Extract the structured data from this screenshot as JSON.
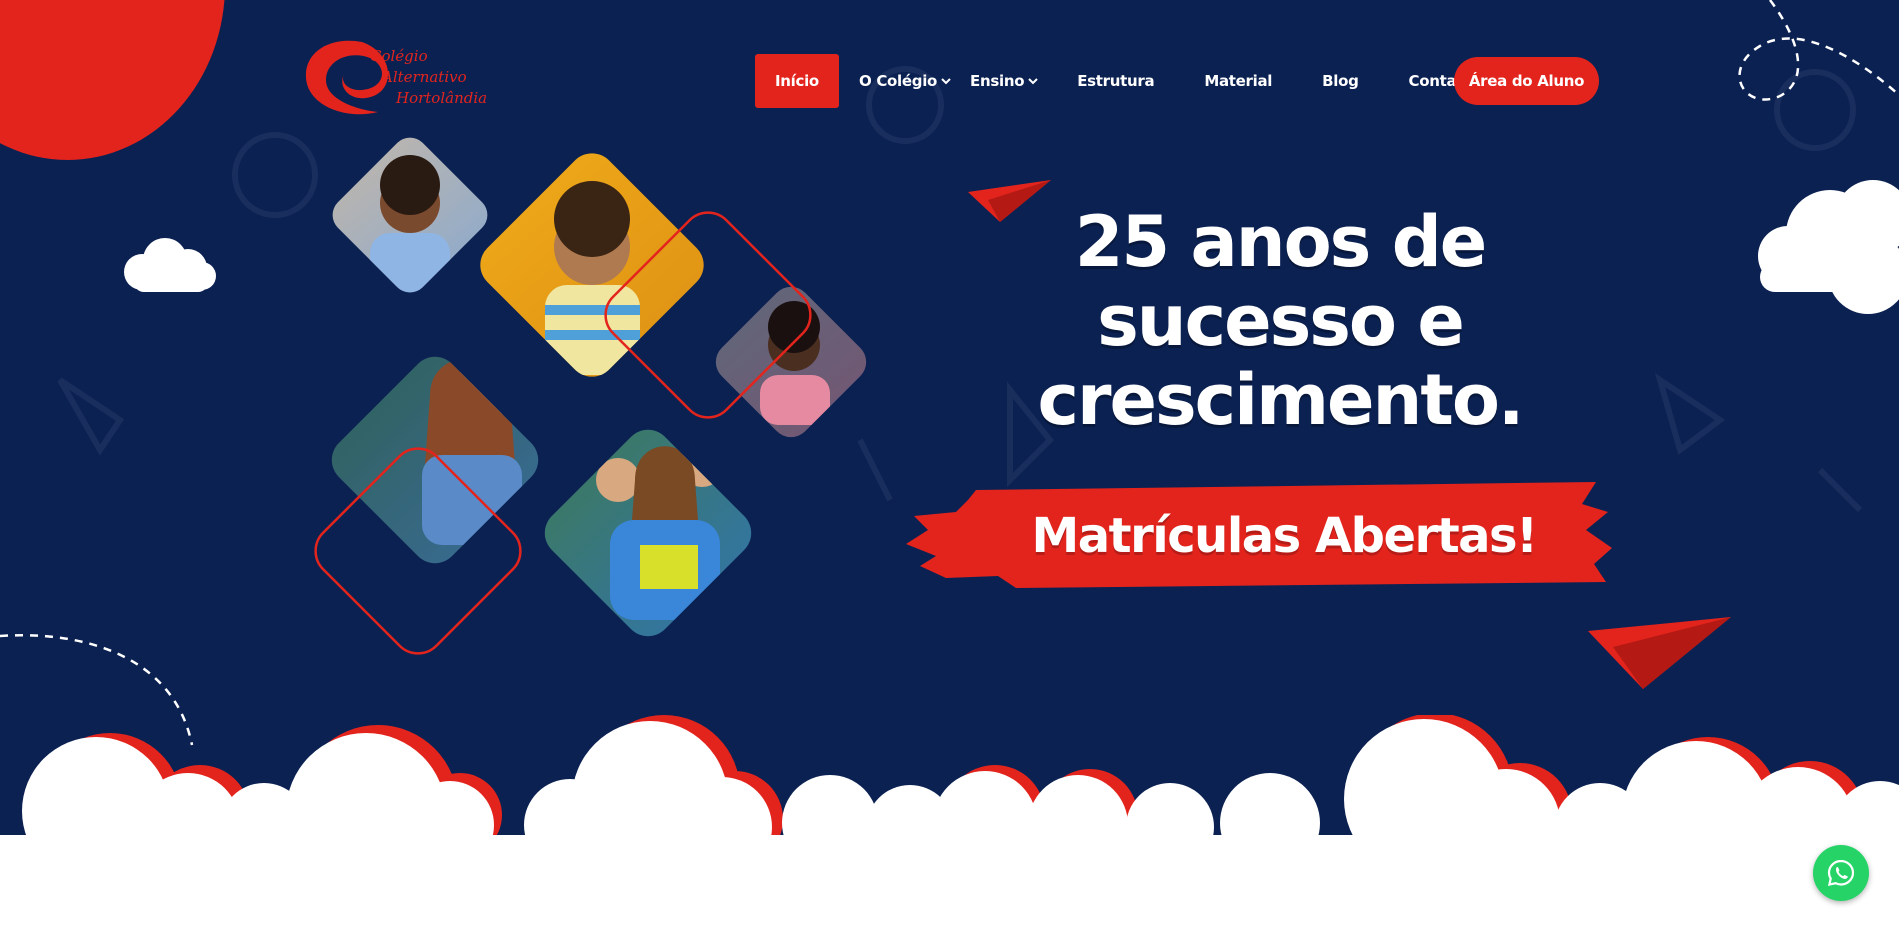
{
  "brand": {
    "logo_lines": [
      "Colégio",
      "Alternativo",
      "Hortolândia"
    ],
    "accent_color": "#e3241d",
    "background_color": "#0b2152"
  },
  "nav": {
    "items": [
      {
        "label": "Início",
        "active": true
      },
      {
        "label": "O Colégio",
        "dropdown": true
      },
      {
        "label": "Ensino",
        "dropdown": true
      },
      {
        "label": "Estrutura"
      },
      {
        "label": "Material"
      },
      {
        "label": "Blog"
      },
      {
        "label": "Contato"
      }
    ],
    "cta_label": "Área do Aluno"
  },
  "hero": {
    "headline_lines": [
      "25 anos de",
      "sucesso e",
      "crescimento."
    ],
    "banner_text": "Matrículas Abertas!",
    "photos": [
      "boy-smiling-photo",
      "boy-backpack-photo",
      "girl-hands-on-cheeks-photo",
      "teen-girl-writing-photo",
      "students-group-photo"
    ]
  },
  "icons": {
    "whatsapp": "whatsapp-icon",
    "paper_plane": "paper-plane-icon",
    "cloud": "cloud-icon"
  }
}
